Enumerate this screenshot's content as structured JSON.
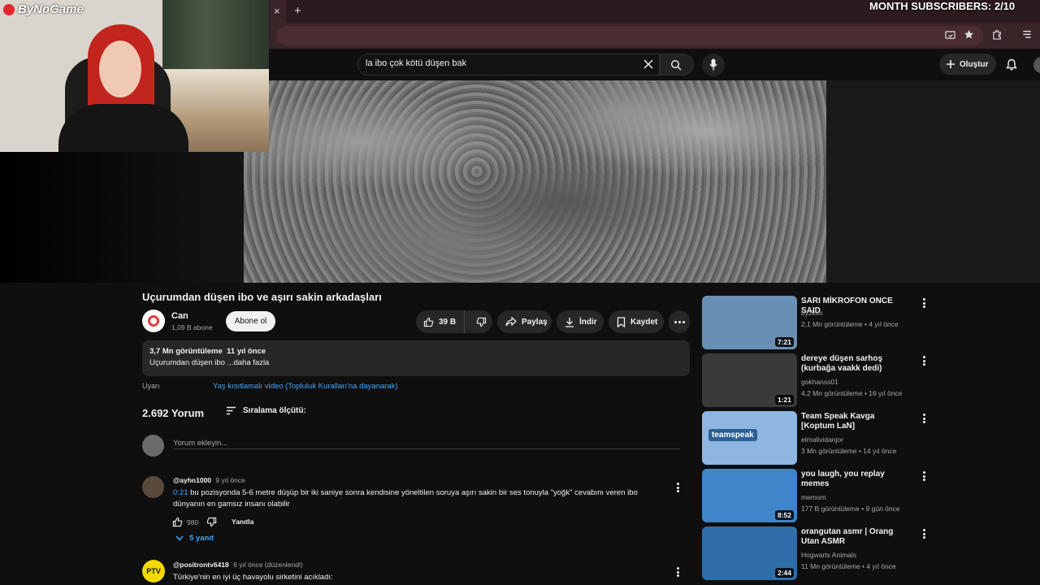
{
  "overlay": {
    "logo_text": "ByNoGame",
    "subs_label": "MONTH SUBSCRIBERS: 2/10"
  },
  "browser": {
    "new_tab_symbol": "+",
    "close_tab_symbol": "×"
  },
  "header": {
    "search_value": "la ibo çok kötü düşen bak",
    "create_label": "Oluştur"
  },
  "video": {
    "title": "Uçurumdan düşen ibo ve aşırı sakin arkadaşları",
    "channel_name": "Can",
    "subscribers": "1,09 B abone",
    "subscribe_label": "Abone ol",
    "likes": "39 B",
    "share_label": "Paylaş",
    "download_label": "İndir",
    "save_label": "Kaydet",
    "views_date": "3,7 Mn görüntüleme  11 yıl önce",
    "description": "Uçurumdan düşen ibo ...daha fazla",
    "warning_label": "Uyarı",
    "warning_link": "Yaş kısıtlamalı video (Topluluk Kuralları'na dayanarak)"
  },
  "comments": {
    "count": "2.692 Yorum",
    "sort_label": "Sıralama ölçütü:",
    "add_placeholder": "Yorum ekleyin...",
    "items": [
      {
        "author": "@ayhn1000",
        "time": "9 yıl önce",
        "timestamp": "0:21",
        "text": "bu pozisyonda 5-6  metre düşüp bir iki saniye sonra kendisine yöneltilen soruya aşırı sakin bir ses tonuyla \"yoğk\" cevabını veren ibo dünyanın en gamsız insanı olabilir",
        "likes": "980",
        "reply_label": "Yanıtla",
        "replies": "5 yanıt"
      },
      {
        "author": "@positrontv6418",
        "time": "6 yıl önce (düzenlendi)",
        "text": "Türkiye'nin en iyi üç havayolu sirketini acıkladı:",
        "avatar_text": "PTV"
      }
    ]
  },
  "recommendations": [
    {
      "title": "SARI MİKROFON ONCE SAID",
      "channel": "byzkim",
      "meta": "2,1 Mn görüntüleme • 4 yıl önce",
      "duration": "7:21",
      "thumb_color": "#6a8fb5"
    },
    {
      "title": "dereye düşen sarhoş (kurbağa vaakk dedi)",
      "channel": "gokhanss01",
      "meta": "4,2 Mn görüntüleme • 16 yıl önce",
      "duration": "1:21",
      "thumb_color": "#3a3a3a"
    },
    {
      "title": "Team Speak Kavga [Koptum LaN]",
      "channel": "elmalividanjor",
      "meta": "3 Mn görüntüleme • 14 yıl önce",
      "duration": "",
      "thumb_color": "#8fb6e0",
      "thumb_text": "teamspeak"
    },
    {
      "title": "you laugh, you replay memes",
      "channel": "memom",
      "meta": "177 B görüntüleme • 9 gün önce",
      "duration": "8:52",
      "thumb_color": "#3e86c9"
    },
    {
      "title": "orangutan asmr | Orang Utan ASMR",
      "channel": "Hogwarts Animals",
      "meta": "11 Mn görüntüleme • 4 yıl önce",
      "duration": "2:44",
      "thumb_color": "#2f6ea8"
    }
  ]
}
